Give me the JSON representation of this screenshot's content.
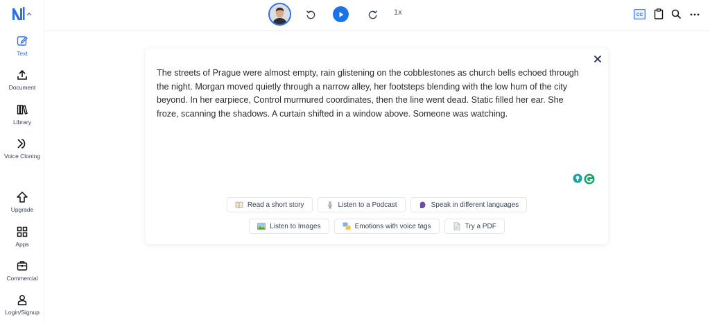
{
  "sidebar": {
    "items": [
      {
        "label": "Text",
        "icon": "pencil-icon"
      },
      {
        "label": "Document",
        "icon": "upload-icon"
      },
      {
        "label": "Library",
        "icon": "books-icon"
      },
      {
        "label": "Voice Cloning",
        "icon": "voice-clone-icon"
      },
      {
        "label": "Upgrade",
        "icon": "arrow-up-icon"
      },
      {
        "label": "Apps",
        "icon": "grid-icon"
      },
      {
        "label": "Commercial",
        "icon": "briefcase-icon"
      },
      {
        "label": "Login/Signup",
        "icon": "user-icon"
      }
    ]
  },
  "player": {
    "speed": "1x"
  },
  "editor": {
    "text": "The streets of Prague were almost empty, rain glistening on the cobblestones as church bells echoed through the night. Morgan moved quietly through a narrow alley, her footsteps blending with the low hum of the city beyond. In her earpiece, Control murmured coordinates, then the line went dead. Static filled her ear. She froze, scanning the shadows. A curtain shifted in a window above. Someone was watching."
  },
  "suggestions": {
    "row1": [
      {
        "label": "Read a short story",
        "icon": "book-icon"
      },
      {
        "label": "Listen to a Podcast",
        "icon": "microphone-icon"
      },
      {
        "label": "Speak in different languages",
        "icon": "speaking-head-icon"
      }
    ],
    "row2": [
      {
        "label": "Listen to Images",
        "icon": "image-icon"
      },
      {
        "label": "Emotions with voice tags",
        "icon": "emotions-icon"
      },
      {
        "label": "Try a PDF",
        "icon": "pdf-icon"
      }
    ]
  },
  "colors": {
    "accent": "#1a73e8",
    "active": "#2f6fe0"
  }
}
